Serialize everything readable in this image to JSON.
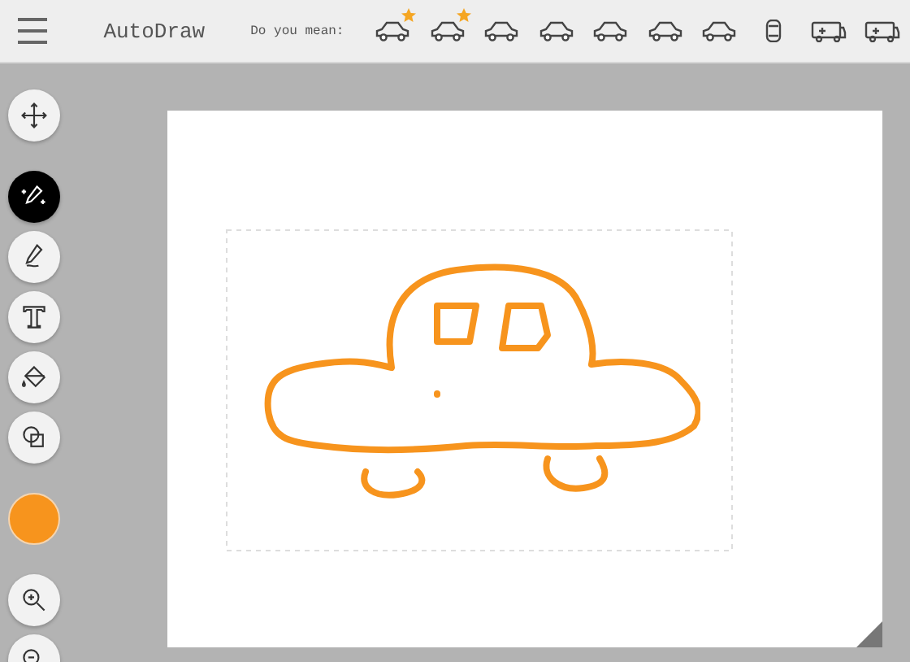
{
  "header": {
    "title": "AutoDraw",
    "suggestion_label": "Do you mean:",
    "suggestions": [
      {
        "starred": true
      },
      {
        "starred": true
      },
      {
        "starred": false
      },
      {
        "starred": false
      },
      {
        "starred": false
      },
      {
        "starred": false
      },
      {
        "starred": false
      },
      {
        "starred": false
      },
      {
        "starred": false
      },
      {
        "starred": false
      }
    ]
  },
  "tools": [
    {
      "kind": "move",
      "selected": false
    },
    {
      "kind": "autodraw",
      "selected": true
    },
    {
      "kind": "draw",
      "selected": false
    },
    {
      "kind": "type",
      "selected": false
    },
    {
      "kind": "fill",
      "selected": false
    },
    {
      "kind": "shape",
      "selected": false
    },
    {
      "kind": "color",
      "color": "#f7941d"
    },
    {
      "kind": "zoom-in",
      "selected": false
    },
    {
      "kind": "zoom-out",
      "selected": false
    }
  ]
}
